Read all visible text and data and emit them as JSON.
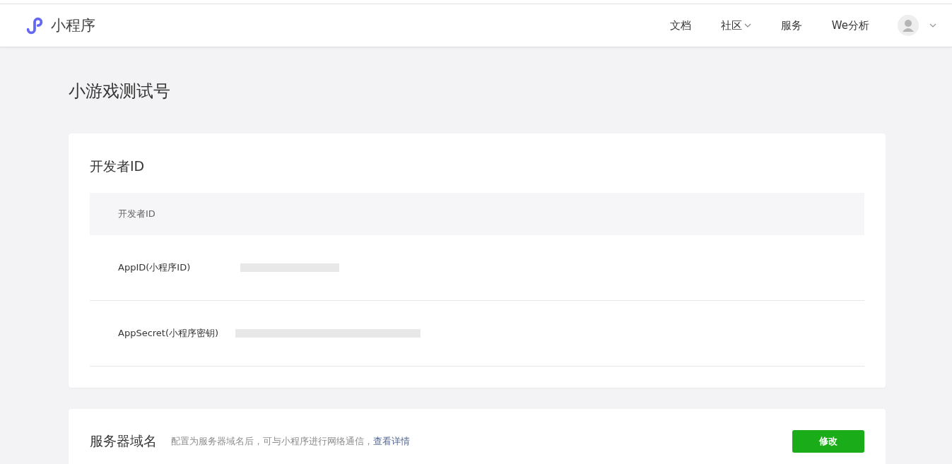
{
  "header": {
    "brand": "小程序",
    "nav": [
      {
        "label": "文档",
        "dropdown": false
      },
      {
        "label": "社区",
        "dropdown": true
      },
      {
        "label": "服务",
        "dropdown": false
      },
      {
        "label": "We分析",
        "dropdown": false
      }
    ]
  },
  "page_title": "小游戏测试号",
  "developer_card": {
    "title": "开发者ID",
    "table_header": "开发者ID",
    "rows": [
      {
        "label": "AppID(小程序ID)",
        "value_hidden": true
      },
      {
        "label": "AppSecret(小程序密钥)",
        "value_hidden": true
      }
    ]
  },
  "server_card": {
    "title": "服务器域名",
    "description": "配置为服务器域名后，可与小程序进行网络通信，",
    "link": "查看详情",
    "button": "修改"
  }
}
